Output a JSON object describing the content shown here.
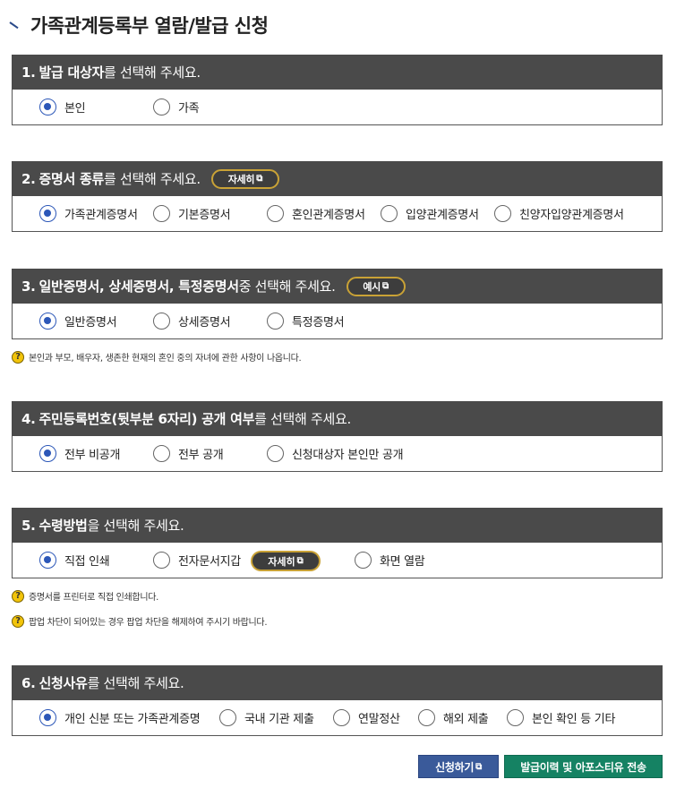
{
  "page": {
    "title": "가족관계등록부 열람/발급 신청"
  },
  "sections": [
    {
      "num": "1.",
      "pre": "",
      "em": "발급 대상자",
      "post": "를 선택해 주세요.",
      "options": [
        {
          "label": "본인",
          "checked": true
        },
        {
          "label": "가족",
          "checked": false
        }
      ]
    },
    {
      "num": "2.",
      "pre": "",
      "em": "증명서 종류",
      "post": "를 선택해 주세요.",
      "button": "자세히",
      "options": [
        {
          "label": "가족관계증명서",
          "checked": true
        },
        {
          "label": "기본증명서",
          "checked": false
        },
        {
          "label": "혼인관계증명서",
          "checked": false
        },
        {
          "label": "입양관계증명서",
          "checked": false
        },
        {
          "label": "친양자입양관계증명서",
          "checked": false
        }
      ]
    },
    {
      "num": "3.",
      "pre": "",
      "em": "일반증명서, 상세증명서, 특정증명서",
      "post": " 중 선택해 주세요.",
      "button": "예시",
      "options": [
        {
          "label": "일반증명서",
          "checked": true
        },
        {
          "label": "상세증명서",
          "checked": false
        },
        {
          "label": "특정증명서",
          "checked": false
        }
      ],
      "notes": [
        "본인과 부모, 배우자, 생존한 현재의 혼인 중의 자녀에 관한 사항이 나옵니다."
      ]
    },
    {
      "num": "4.",
      "pre": "",
      "em": "주민등록번호(뒷부분 6자리) 공개 여부",
      "post": "를 선택해 주세요.",
      "options": [
        {
          "label": "전부 비공개",
          "checked": true
        },
        {
          "label": "전부 공개",
          "checked": false
        },
        {
          "label": "신청대상자 본인만 공개",
          "checked": false
        }
      ]
    },
    {
      "num": "5.",
      "pre": "",
      "em": "수령방법",
      "post": "을 선택해 주세요.",
      "inline_button": "자세히",
      "options": [
        {
          "label": "직접 인쇄",
          "checked": true
        },
        {
          "label": "전자문서지갑",
          "checked": false
        },
        {
          "label": "화면 열람",
          "checked": false
        }
      ],
      "notes": [
        "증명서를 프린터로 직접 인쇄합니다.",
        "팝업 차단이 되어있는 경우 팝업 차단을 해제하여 주시기 바랍니다."
      ]
    },
    {
      "num": "6.",
      "pre": "",
      "em": "신청사유",
      "post": "를 선택해 주세요.",
      "options": [
        {
          "label": "개인 신분 또는 가족관계증명",
          "checked": true
        },
        {
          "label": "국내 기관 제출",
          "checked": false
        },
        {
          "label": "연말정산",
          "checked": false
        },
        {
          "label": "해외 제출",
          "checked": false
        },
        {
          "label": "본인 확인 등 기타",
          "checked": false
        }
      ]
    }
  ],
  "actions": {
    "apply": "신청하기",
    "history": "발급이력 및 아포스티유 전송"
  },
  "icons": {
    "external": "external-link-icon",
    "help": "question-icon"
  },
  "colors": {
    "header_bg": "#4a4a4a",
    "radio_selected": "#2c57b8",
    "pill_border": "#c9a236",
    "apply_button": "#3a5a9a",
    "history_button": "#158263",
    "help_icon": "#f2c40a"
  }
}
